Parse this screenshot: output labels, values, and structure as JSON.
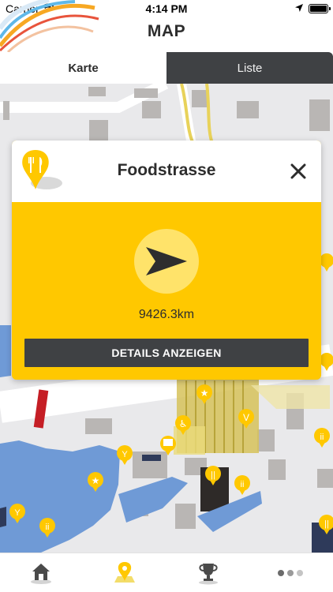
{
  "status_bar": {
    "carrier": "Carrier",
    "time": "4:14 PM"
  },
  "nav": {
    "title": "MAP"
  },
  "segments": [
    {
      "label": "Karte",
      "active": true
    },
    {
      "label": "Liste",
      "active": false
    }
  ],
  "popup": {
    "title": "Foodstrasse",
    "distance": "9426.3km",
    "button_label": "DETAILS ANZEIGEN",
    "icon": "fork-knife-icon"
  },
  "tabbar": {
    "items": [
      {
        "icon": "home-icon",
        "active": false
      },
      {
        "icon": "map-pin-icon",
        "active": true
      },
      {
        "icon": "trophy-icon",
        "active": false
      },
      {
        "icon": "more-dots-icon",
        "active": false
      }
    ]
  },
  "colors": {
    "accent": "#ffc800",
    "dark": "#3f4144",
    "water": "#6f9ad6",
    "map_bg": "#e8e8ea",
    "building": "#b9b6b4"
  }
}
